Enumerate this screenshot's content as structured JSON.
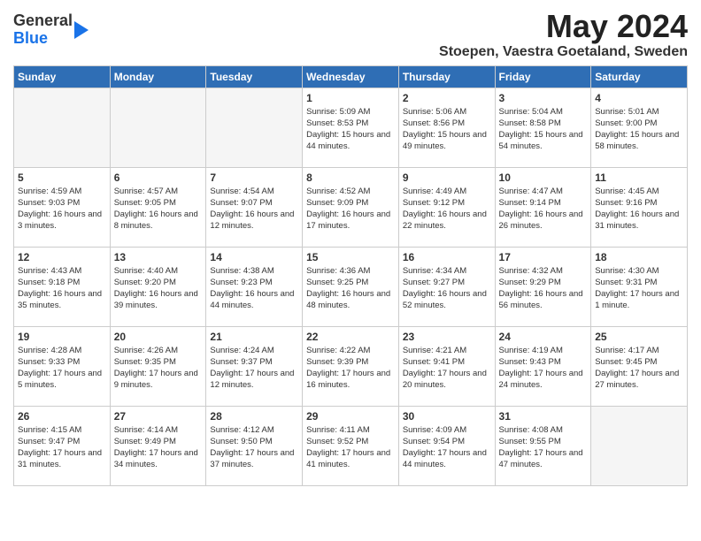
{
  "header": {
    "logo_line1": "General",
    "logo_line2": "Blue",
    "title": "May 2024",
    "subtitle": "Stoepen, Vaestra Goetaland, Sweden"
  },
  "weekdays": [
    "Sunday",
    "Monday",
    "Tuesday",
    "Wednesday",
    "Thursday",
    "Friday",
    "Saturday"
  ],
  "weeks": [
    [
      {
        "day": "",
        "sunrise": "",
        "sunset": "",
        "daylight": ""
      },
      {
        "day": "",
        "sunrise": "",
        "sunset": "",
        "daylight": ""
      },
      {
        "day": "",
        "sunrise": "",
        "sunset": "",
        "daylight": ""
      },
      {
        "day": "1",
        "sunrise": "Sunrise: 5:09 AM",
        "sunset": "Sunset: 8:53 PM",
        "daylight": "Daylight: 15 hours and 44 minutes."
      },
      {
        "day": "2",
        "sunrise": "Sunrise: 5:06 AM",
        "sunset": "Sunset: 8:56 PM",
        "daylight": "Daylight: 15 hours and 49 minutes."
      },
      {
        "day": "3",
        "sunrise": "Sunrise: 5:04 AM",
        "sunset": "Sunset: 8:58 PM",
        "daylight": "Daylight: 15 hours and 54 minutes."
      },
      {
        "day": "4",
        "sunrise": "Sunrise: 5:01 AM",
        "sunset": "Sunset: 9:00 PM",
        "daylight": "Daylight: 15 hours and 58 minutes."
      }
    ],
    [
      {
        "day": "5",
        "sunrise": "Sunrise: 4:59 AM",
        "sunset": "Sunset: 9:03 PM",
        "daylight": "Daylight: 16 hours and 3 minutes."
      },
      {
        "day": "6",
        "sunrise": "Sunrise: 4:57 AM",
        "sunset": "Sunset: 9:05 PM",
        "daylight": "Daylight: 16 hours and 8 minutes."
      },
      {
        "day": "7",
        "sunrise": "Sunrise: 4:54 AM",
        "sunset": "Sunset: 9:07 PM",
        "daylight": "Daylight: 16 hours and 12 minutes."
      },
      {
        "day": "8",
        "sunrise": "Sunrise: 4:52 AM",
        "sunset": "Sunset: 9:09 PM",
        "daylight": "Daylight: 16 hours and 17 minutes."
      },
      {
        "day": "9",
        "sunrise": "Sunrise: 4:49 AM",
        "sunset": "Sunset: 9:12 PM",
        "daylight": "Daylight: 16 hours and 22 minutes."
      },
      {
        "day": "10",
        "sunrise": "Sunrise: 4:47 AM",
        "sunset": "Sunset: 9:14 PM",
        "daylight": "Daylight: 16 hours and 26 minutes."
      },
      {
        "day": "11",
        "sunrise": "Sunrise: 4:45 AM",
        "sunset": "Sunset: 9:16 PM",
        "daylight": "Daylight: 16 hours and 31 minutes."
      }
    ],
    [
      {
        "day": "12",
        "sunrise": "Sunrise: 4:43 AM",
        "sunset": "Sunset: 9:18 PM",
        "daylight": "Daylight: 16 hours and 35 minutes."
      },
      {
        "day": "13",
        "sunrise": "Sunrise: 4:40 AM",
        "sunset": "Sunset: 9:20 PM",
        "daylight": "Daylight: 16 hours and 39 minutes."
      },
      {
        "day": "14",
        "sunrise": "Sunrise: 4:38 AM",
        "sunset": "Sunset: 9:23 PM",
        "daylight": "Daylight: 16 hours and 44 minutes."
      },
      {
        "day": "15",
        "sunrise": "Sunrise: 4:36 AM",
        "sunset": "Sunset: 9:25 PM",
        "daylight": "Daylight: 16 hours and 48 minutes."
      },
      {
        "day": "16",
        "sunrise": "Sunrise: 4:34 AM",
        "sunset": "Sunset: 9:27 PM",
        "daylight": "Daylight: 16 hours and 52 minutes."
      },
      {
        "day": "17",
        "sunrise": "Sunrise: 4:32 AM",
        "sunset": "Sunset: 9:29 PM",
        "daylight": "Daylight: 16 hours and 56 minutes."
      },
      {
        "day": "18",
        "sunrise": "Sunrise: 4:30 AM",
        "sunset": "Sunset: 9:31 PM",
        "daylight": "Daylight: 17 hours and 1 minute."
      }
    ],
    [
      {
        "day": "19",
        "sunrise": "Sunrise: 4:28 AM",
        "sunset": "Sunset: 9:33 PM",
        "daylight": "Daylight: 17 hours and 5 minutes."
      },
      {
        "day": "20",
        "sunrise": "Sunrise: 4:26 AM",
        "sunset": "Sunset: 9:35 PM",
        "daylight": "Daylight: 17 hours and 9 minutes."
      },
      {
        "day": "21",
        "sunrise": "Sunrise: 4:24 AM",
        "sunset": "Sunset: 9:37 PM",
        "daylight": "Daylight: 17 hours and 12 minutes."
      },
      {
        "day": "22",
        "sunrise": "Sunrise: 4:22 AM",
        "sunset": "Sunset: 9:39 PM",
        "daylight": "Daylight: 17 hours and 16 minutes."
      },
      {
        "day": "23",
        "sunrise": "Sunrise: 4:21 AM",
        "sunset": "Sunset: 9:41 PM",
        "daylight": "Daylight: 17 hours and 20 minutes."
      },
      {
        "day": "24",
        "sunrise": "Sunrise: 4:19 AM",
        "sunset": "Sunset: 9:43 PM",
        "daylight": "Daylight: 17 hours and 24 minutes."
      },
      {
        "day": "25",
        "sunrise": "Sunrise: 4:17 AM",
        "sunset": "Sunset: 9:45 PM",
        "daylight": "Daylight: 17 hours and 27 minutes."
      }
    ],
    [
      {
        "day": "26",
        "sunrise": "Sunrise: 4:15 AM",
        "sunset": "Sunset: 9:47 PM",
        "daylight": "Daylight: 17 hours and 31 minutes."
      },
      {
        "day": "27",
        "sunrise": "Sunrise: 4:14 AM",
        "sunset": "Sunset: 9:49 PM",
        "daylight": "Daylight: 17 hours and 34 minutes."
      },
      {
        "day": "28",
        "sunrise": "Sunrise: 4:12 AM",
        "sunset": "Sunset: 9:50 PM",
        "daylight": "Daylight: 17 hours and 37 minutes."
      },
      {
        "day": "29",
        "sunrise": "Sunrise: 4:11 AM",
        "sunset": "Sunset: 9:52 PM",
        "daylight": "Daylight: 17 hours and 41 minutes."
      },
      {
        "day": "30",
        "sunrise": "Sunrise: 4:09 AM",
        "sunset": "Sunset: 9:54 PM",
        "daylight": "Daylight: 17 hours and 44 minutes."
      },
      {
        "day": "31",
        "sunrise": "Sunrise: 4:08 AM",
        "sunset": "Sunset: 9:55 PM",
        "daylight": "Daylight: 17 hours and 47 minutes."
      },
      {
        "day": "",
        "sunrise": "",
        "sunset": "",
        "daylight": ""
      }
    ]
  ]
}
